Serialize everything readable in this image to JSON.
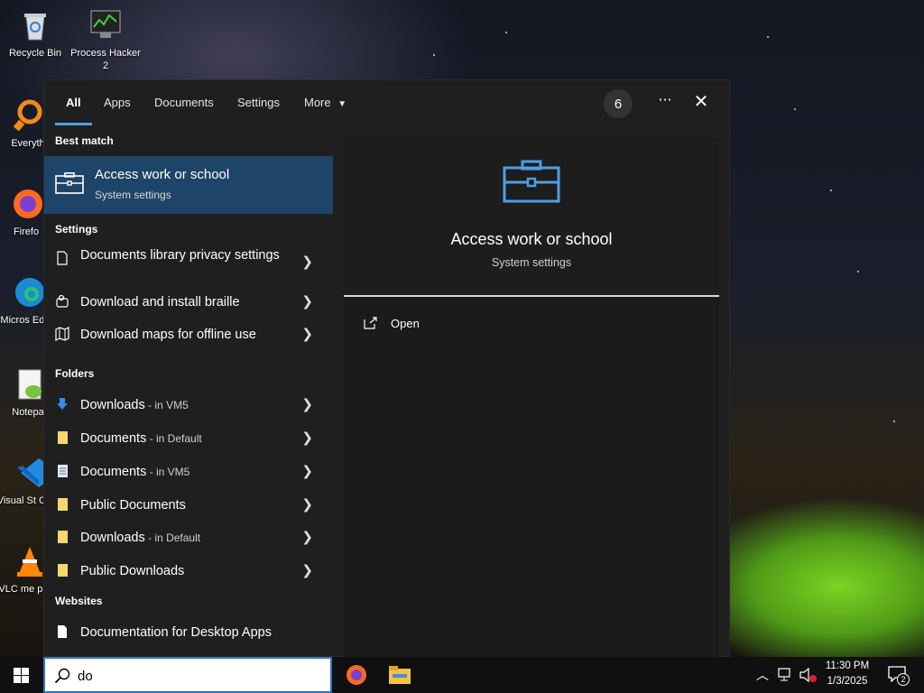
{
  "desktop": {
    "icons": [
      {
        "label": "Recycle Bin"
      },
      {
        "label": "Process Hacker 2"
      },
      {
        "label": "Everyth"
      },
      {
        "label": "Firefo"
      },
      {
        "label": "Micros Edge"
      },
      {
        "label": "Notepa"
      },
      {
        "label": "Visual St Code"
      },
      {
        "label": "VLC me playe"
      }
    ]
  },
  "search": {
    "tabs": [
      {
        "label": "All"
      },
      {
        "label": "Apps"
      },
      {
        "label": "Documents"
      },
      {
        "label": "Settings"
      },
      {
        "label": "More"
      }
    ],
    "badge_count": "6",
    "ellipsis": "···",
    "close": "✕",
    "sections": {
      "best_match": "Best match",
      "settings": "Settings",
      "folders": "Folders",
      "websites": "Websites"
    },
    "best_match": {
      "title": "Access work or school",
      "subtitle": "System settings"
    },
    "settings_items": [
      {
        "label": "Documents library privacy settings"
      },
      {
        "label": "Download and install braille"
      },
      {
        "label": "Download maps for offline use"
      }
    ],
    "folder_items": [
      {
        "label": "Downloads",
        "location": " - in VM5"
      },
      {
        "label": "Documents",
        "location": " - in Default"
      },
      {
        "label": "Documents",
        "location": " - in VM5"
      },
      {
        "label": "Public Documents",
        "location": ""
      },
      {
        "label": "Downloads",
        "location": " - in Default"
      },
      {
        "label": "Public Downloads",
        "location": ""
      }
    ],
    "website_items": [
      {
        "label": "Documentation for Desktop Apps"
      }
    ],
    "preview": {
      "title": "Access work or school",
      "subtitle": "System settings",
      "action_open": "Open"
    },
    "query": "do"
  },
  "taskbar": {
    "time": "11:30 PM",
    "date": "1/3/2025",
    "notification_count": "2"
  },
  "colors": {
    "accent": "#4ca0e6",
    "selection": "#1e4467",
    "panel": "#1f1f1f"
  }
}
